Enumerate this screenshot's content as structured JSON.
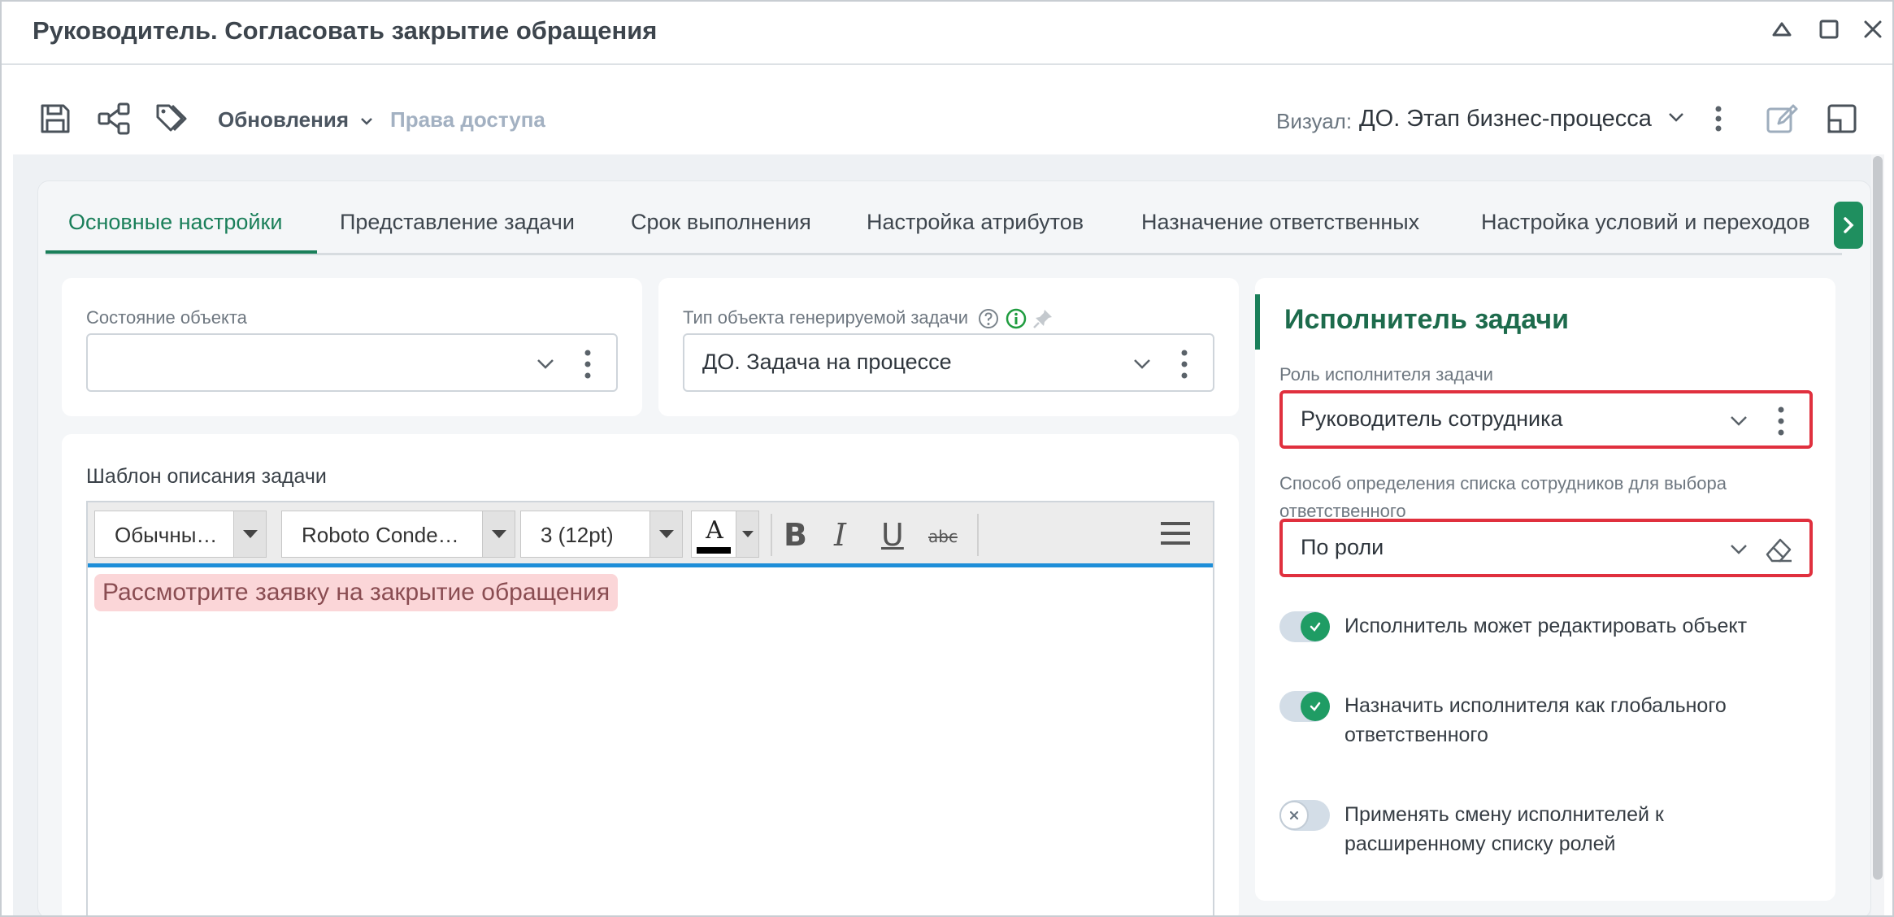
{
  "window": {
    "title": "Руководитель. Согласовать закрытие обращения"
  },
  "toolbar": {
    "updates_label": "Обновления",
    "access_label": "Права доступа",
    "visual_label": "Визуал:",
    "visual_value": "ДО. Этап бизнес-процесса"
  },
  "tabs": [
    {
      "label": "Основные настройки",
      "active": true
    },
    {
      "label": "Представление задачи",
      "active": false
    },
    {
      "label": "Срок выполнения",
      "active": false
    },
    {
      "label": "Настройка атрибутов",
      "active": false
    },
    {
      "label": "Назначение ответственных",
      "active": false
    },
    {
      "label": "Настройка условий и переходов",
      "active": false
    }
  ],
  "object_state": {
    "label": "Состояние объекта",
    "value": ""
  },
  "task_type": {
    "label": "Тип объекта генерируемой задачи",
    "value": "ДО. Задача на процессе"
  },
  "editor": {
    "label": "Шаблон описания задачи",
    "style_select": "Обычны…",
    "font_select": "Roboto Conde…",
    "size_select": "3 (12pt)",
    "color_letter": "A",
    "bold": "B",
    "italic": "I",
    "underline": "U",
    "strike": "abc",
    "content": "Рассмотрите заявку на закрытие обращения"
  },
  "assignee": {
    "title": "Исполнитель задачи",
    "role_label": "Роль исполнителя задачи",
    "role_value": "Руководитель сотрудника",
    "method_label_1": "Способ определения списка сотрудников для выбора",
    "method_label_2": "ответственного",
    "method_value": "По роли",
    "toggles": [
      {
        "line1": "Исполнитель может редактировать объект",
        "line2": "",
        "on": true
      },
      {
        "line1": "Назначить исполнителя как глобального",
        "line2": "ответственного",
        "on": true
      },
      {
        "line1": "Применять смену исполнителей к",
        "line2": "расширенному списку ролей",
        "on": false
      }
    ]
  },
  "colors": {
    "accent_green": "#1a7f5a",
    "highlight_red": "#e0303e",
    "editor_blue": "#1e8ed8"
  }
}
